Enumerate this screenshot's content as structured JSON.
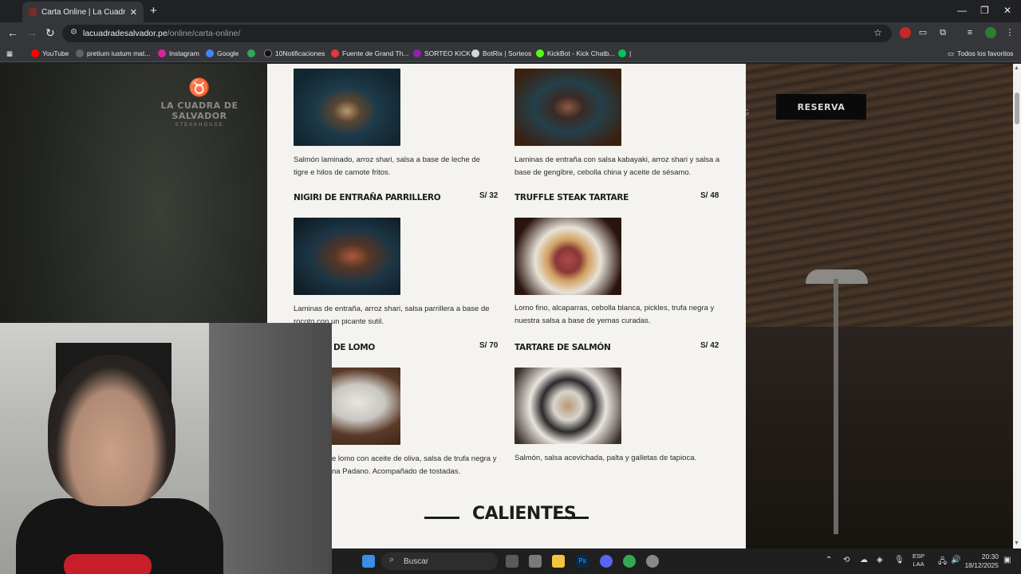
{
  "browser": {
    "tab_title": "Carta Online | La Cuadra de Sal",
    "url_domain": "lacuadradesalvador.pe",
    "url_path": "/online/carta-online/",
    "bookmarks": [
      {
        "label": "YouTube",
        "color": "#ff0000"
      },
      {
        "label": "pretium iustum mat...",
        "color": "#5f6368"
      },
      {
        "label": "Instagram",
        "color": "#d6249f"
      },
      {
        "label": "Google",
        "color": "#4285f4"
      },
      {
        "label": "",
        "color": "#34a853"
      },
      {
        "label": "10Notificaciones",
        "color": "#000000"
      },
      {
        "label": "Fuente de Grand Th...",
        "color": "#e53935"
      },
      {
        "label": "SORTEO KICK",
        "color": "#8e24aa"
      },
      {
        "label": "BotRix | Sorteos",
        "color": "#cfd8dc"
      },
      {
        "label": "KickBot - Kick Chatb...",
        "color": "#53fc18"
      },
      {
        "label": "",
        "color": "#00c853"
      }
    ],
    "all_bookmarks": "Todos los favoritos"
  },
  "site": {
    "logo_name": "LA CUADRA DE SALVADOR",
    "logo_sub": "STEAKHOUSE",
    "reserve_button": "RESERVA",
    "nav_fragment": "G"
  },
  "menu": {
    "row1": [
      {
        "desc": "Salmón laminado, arroz shari, salsa a base de leche de tigre e hilos de camote fritos."
      },
      {
        "desc": "Laminas de entraña con salsa kabayaki, arroz shari y salsa a base de gengibre, cebolla china y aceite de sésamo."
      }
    ],
    "row2": [
      {
        "name": "NIGIRI DE ENTRAÑA PARRILLERO",
        "price": "S/ 32",
        "desc": "Laminas de entraña, arroz shari, salsa parrillera a base de rocoto con un picante sutil."
      },
      {
        "name": "TRUFFLE STEAK TARTARE",
        "price": "S/ 48",
        "desc": "Lomo fino, alcaparras, cebolla blanca, pickles, trufa negra y nuestra salsa a base de yemas curadas."
      }
    ],
    "row3": [
      {
        "name": "DE LOMO",
        "price": "S/ 70",
        "desc1": "e lomo con aceite de oliva, salsa de trufa negra y",
        "desc2": "na Padano. Acompañado de tostadas."
      },
      {
        "name": "TARTARE DE SALMÓN",
        "price": "S/ 42",
        "desc": "Salmón, salsa acevichada, palta y galletas de tapioca."
      }
    ],
    "section_title": "CALIENTES"
  },
  "taskbar": {
    "search_placeholder": "Buscar",
    "lang_top": "ESP",
    "lang_bottom": "LAA",
    "time": "20:30",
    "date": "18/12/2025"
  }
}
